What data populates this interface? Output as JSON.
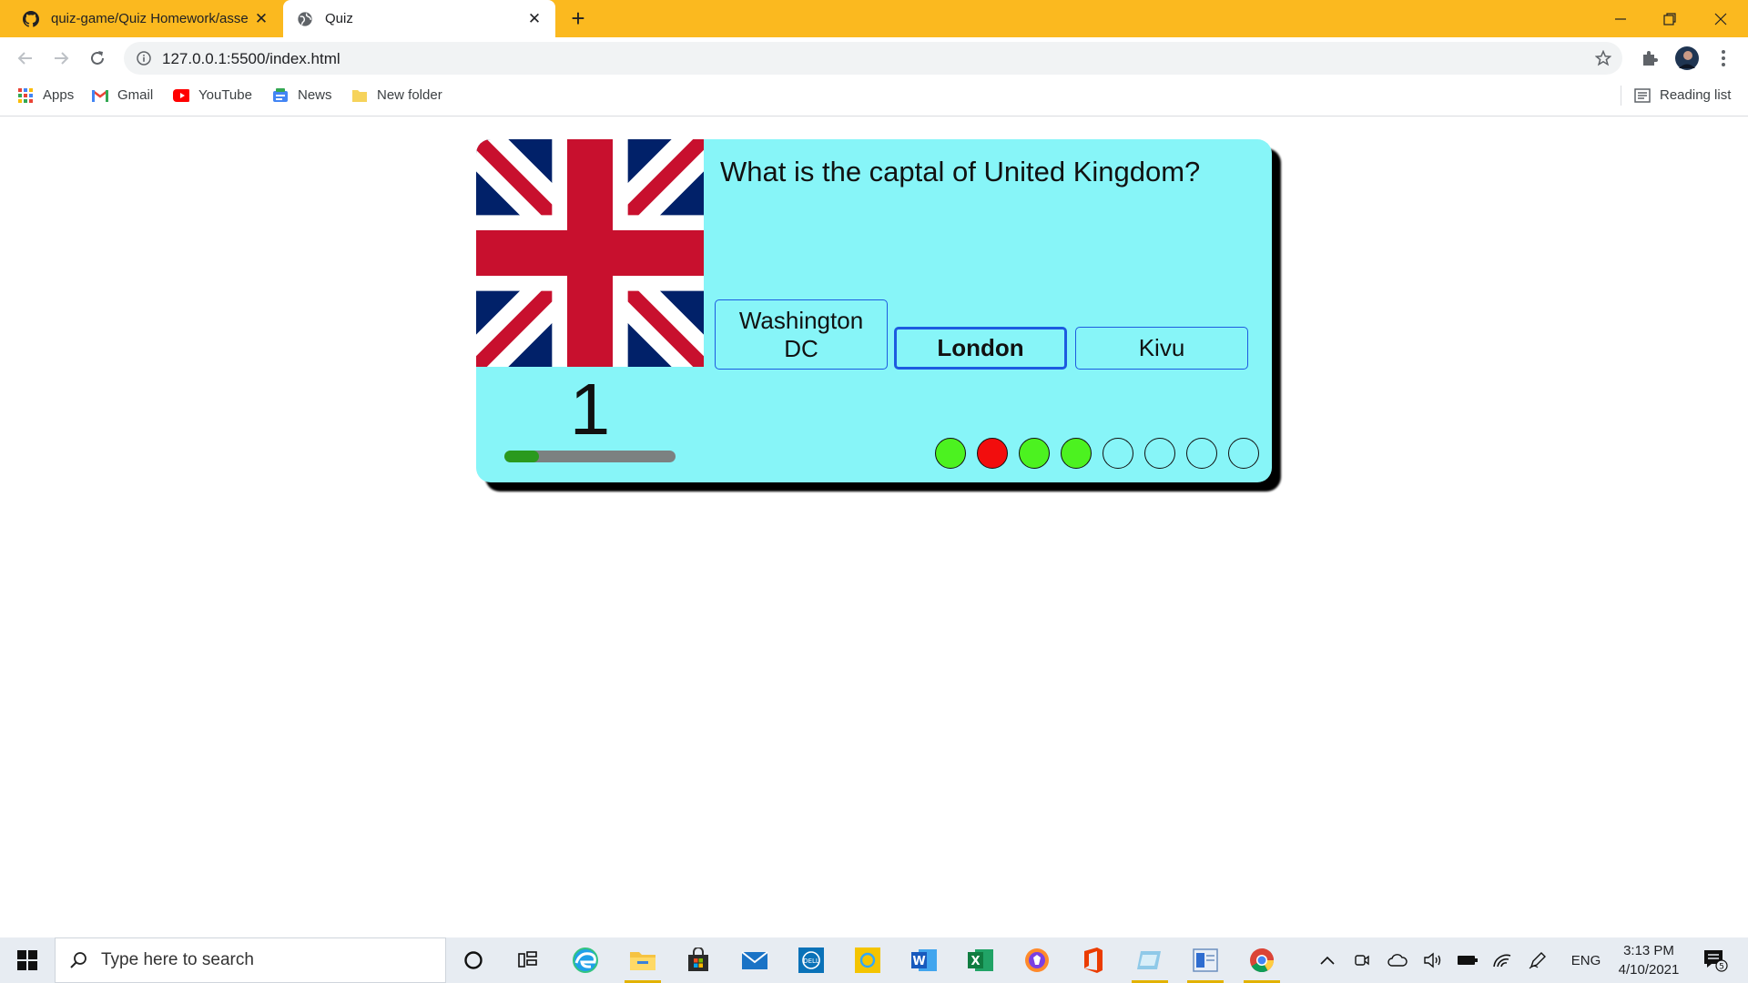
{
  "browser": {
    "tabs": [
      {
        "title": "quiz-game/Quiz Homework/asse",
        "icon": "github-icon",
        "active": false
      },
      {
        "title": "Quiz",
        "icon": "globe-icon",
        "active": true
      }
    ],
    "url": "127.0.0.1:5500/index.html",
    "bookmarks": [
      {
        "label": "Apps",
        "icon": "apps-grid-icon"
      },
      {
        "label": "Gmail",
        "icon": "gmail-icon"
      },
      {
        "label": "YouTube",
        "icon": "youtube-icon"
      },
      {
        "label": "News",
        "icon": "news-icon"
      },
      {
        "label": "New folder",
        "icon": "folder-icon"
      }
    ],
    "reading_list": "Reading list",
    "accent_color": "#fbb91f"
  },
  "quiz": {
    "question": "What is the captal of United Kingdom?",
    "flag": "united-kingdom-flag",
    "answers": [
      "Washington DC",
      "London",
      "Kivu"
    ],
    "selected_answer": "London",
    "question_number": "1",
    "progress": 0.2,
    "results": [
      "correct",
      "wrong",
      "correct",
      "correct",
      "pending",
      "pending",
      "pending",
      "pending"
    ],
    "colors": {
      "card": "#87f5f8",
      "correct": "#4cf220",
      "wrong": "#f20d0d",
      "pending": "#87f5f8",
      "progress": "#2a9a1e"
    }
  },
  "taskbar": {
    "search_placeholder": "Type here to search",
    "language": "ENG",
    "time": "3:13 PM",
    "date": "4/10/2021",
    "notifications": "5"
  }
}
